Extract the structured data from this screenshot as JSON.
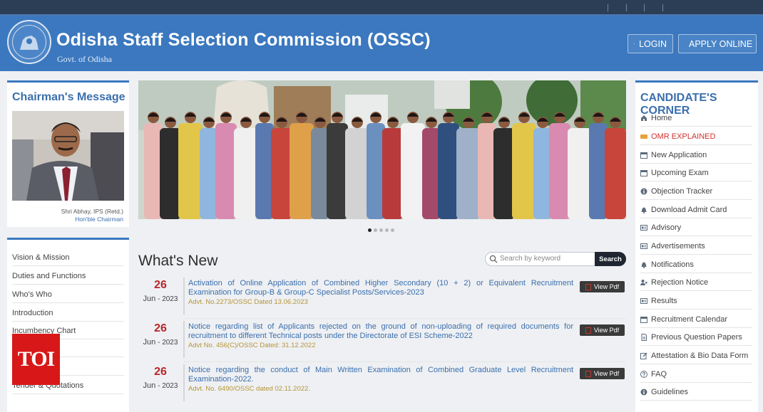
{
  "header": {
    "title": "Odisha Staff Selection Commission  (OSSC)",
    "subtitle": "Govt. of Odisha",
    "login_label": "LOGIN",
    "apply_label": "APPLY ONLINE",
    "brand_color": "#3b78bf"
  },
  "chairman": {
    "title": "Chairman's Message",
    "name": "Shri Abhay, IPS (Retd.)",
    "position": "Hon'ble Chairman"
  },
  "left_menu": [
    {
      "label": "Vision & Mission"
    },
    {
      "label": "Duties and Functions"
    },
    {
      "label": "Who's Who"
    },
    {
      "label": "Introduction"
    },
    {
      "label": "Incumbency Chart"
    },
    {
      "label": "Tender & Quotations"
    }
  ],
  "watermark": {
    "text": "TOI"
  },
  "slider": {
    "dots": 5,
    "active": 0
  },
  "whats_new": {
    "title": "What's New",
    "search_placeholder": "Search by keyword",
    "search_button": "Search",
    "view_pdf_label": "View Pdf",
    "items": [
      {
        "day": "26",
        "month": "Jun",
        "year": "2023",
        "text": "Activation of Online Application of Combined Higher Secondary (10 + 2) or Equivalent Recruitment Examination for Group-B & Group-C Specialist Posts/Services-2023",
        "advt": "Advt. No.2273/OSSC Dated 13.06.2023"
      },
      {
        "day": "26",
        "month": "Jun",
        "year": "2023",
        "text": "Notice regarding list of Applicants rejected on the ground of non-uploading of required documents for recruitment to different Technical posts under the Directorate of ESI Scheme-2022",
        "advt": "Advt No. 456(C)/OSSC Dated: 31.12.2022"
      },
      {
        "day": "26",
        "month": "Jun",
        "year": "2023",
        "text": "Notice regarding the conduct of Main Written Examination of Combined Graduate Level Recruitment Examination-2022.",
        "advt": "Advt. No. 6490/OSSC dated 02.11.2022."
      }
    ]
  },
  "candidate_corner": {
    "title": "CANDIDATE'S CORNER",
    "items": [
      {
        "label": "Home",
        "icon": "home-icon"
      },
      {
        "label": "OMR EXPLAINED",
        "icon": "new-badge-icon",
        "highlight": true
      },
      {
        "label": "New Application",
        "icon": "calendar-icon"
      },
      {
        "label": "Upcoming Exam",
        "icon": "calendar-icon"
      },
      {
        "label": "Objection Tracker",
        "icon": "info-icon"
      },
      {
        "label": "Download Admit Card",
        "icon": "bell-icon"
      },
      {
        "label": "Advisory",
        "icon": "id-card-icon"
      },
      {
        "label": "Advertisements",
        "icon": "id-card-icon"
      },
      {
        "label": "Notifications",
        "icon": "bell-icon"
      },
      {
        "label": "Rejection Notice",
        "icon": "user-x-icon"
      },
      {
        "label": "Results",
        "icon": "id-card-icon"
      },
      {
        "label": "Recruitment Calendar",
        "icon": "calendar-icon"
      },
      {
        "label": "Previous Question Papers",
        "icon": "document-icon"
      },
      {
        "label": "Attestation & Bio Data Form",
        "icon": "edit-icon"
      },
      {
        "label": "FAQ",
        "icon": "question-icon"
      },
      {
        "label": "Guidelines",
        "icon": "info-icon"
      }
    ]
  }
}
